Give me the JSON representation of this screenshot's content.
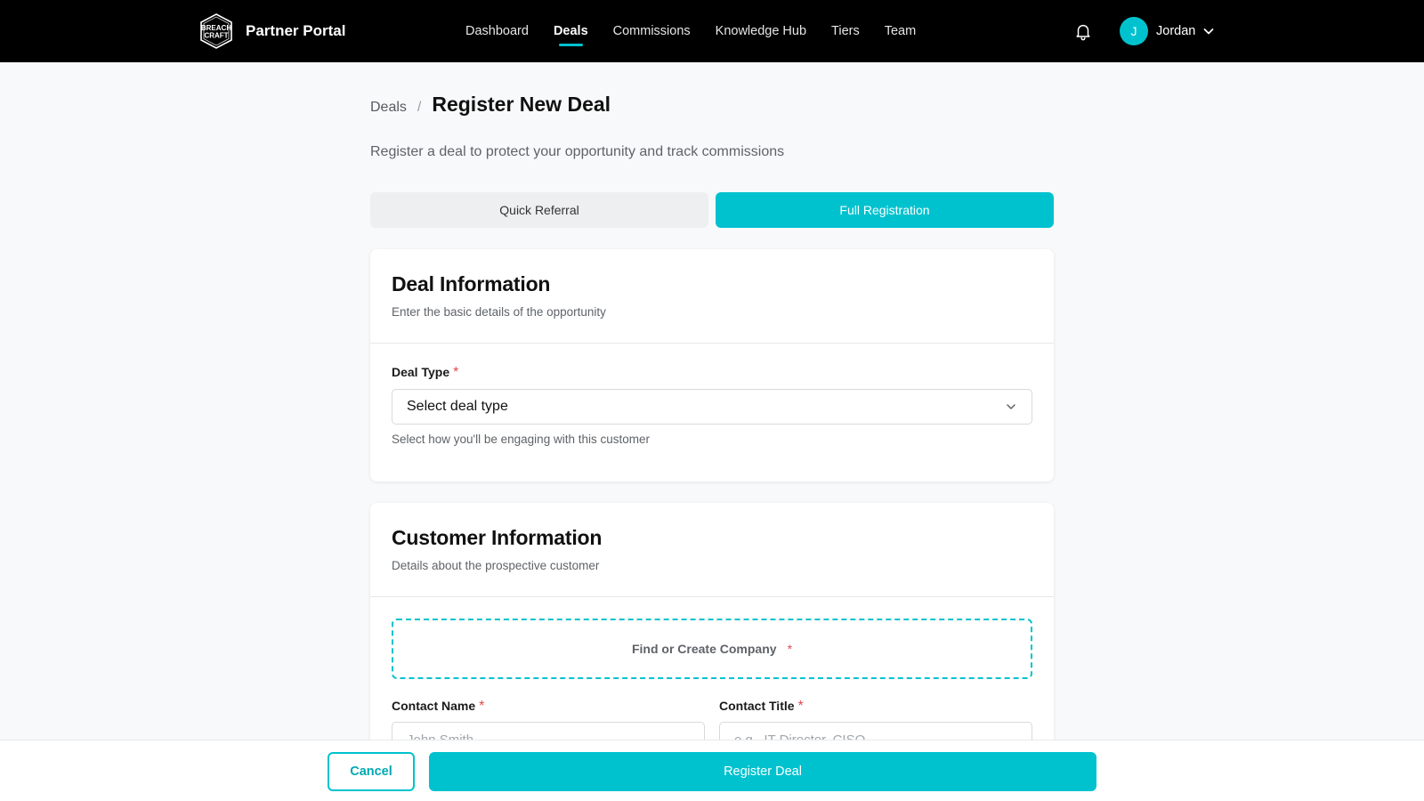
{
  "colors": {
    "accent": "#00c2ce",
    "navbar_bg": "#000000",
    "page_bg": "#f8f9fa",
    "required": "#e5484d"
  },
  "navbar": {
    "logo_icon": "breachcraft-shield-logo",
    "logo_text": [
      "BREACH",
      "CRAFT"
    ],
    "brand": "Partner Portal",
    "links": [
      {
        "label": "Dashboard",
        "active": false
      },
      {
        "label": "Deals",
        "active": true
      },
      {
        "label": "Commissions",
        "active": false
      },
      {
        "label": "Knowledge Hub",
        "active": false
      },
      {
        "label": "Tiers",
        "active": false
      },
      {
        "label": "Team",
        "active": false
      }
    ],
    "notification_icon": "bell-icon",
    "user": {
      "initial": "J",
      "name": "Jordan",
      "menu_icon": "chevron-down-icon"
    }
  },
  "page": {
    "breadcrumb_parent": "Deals",
    "breadcrumb_separator": "/",
    "title": "Register New Deal",
    "subtitle": "Register a deal to protect your opportunity and track commissions"
  },
  "mode_toggle": {
    "options": [
      "Quick Referral",
      "Full Registration"
    ],
    "selected": "Full Registration"
  },
  "deal_info": {
    "title": "Deal Information",
    "description": "Enter the basic details of the opportunity",
    "deal_type": {
      "label": "Deal Type",
      "required_mark": "*",
      "value": "Select deal type",
      "help": "Select how you'll be engaging with this customer"
    }
  },
  "customer_info": {
    "title": "Customer Information",
    "description": "Details about the prospective customer",
    "company_finder": {
      "label": "Find or Create Company",
      "required_mark": "*"
    },
    "contact_name": {
      "label": "Contact Name",
      "required_mark": "*",
      "placeholder": "John Smith",
      "value": ""
    },
    "contact_title": {
      "label": "Contact Title",
      "required_mark": "*",
      "placeholder": "e.g., IT Director, CISO",
      "value": ""
    }
  },
  "footer": {
    "cancel_label": "Cancel",
    "submit_label": "Register Deal"
  }
}
